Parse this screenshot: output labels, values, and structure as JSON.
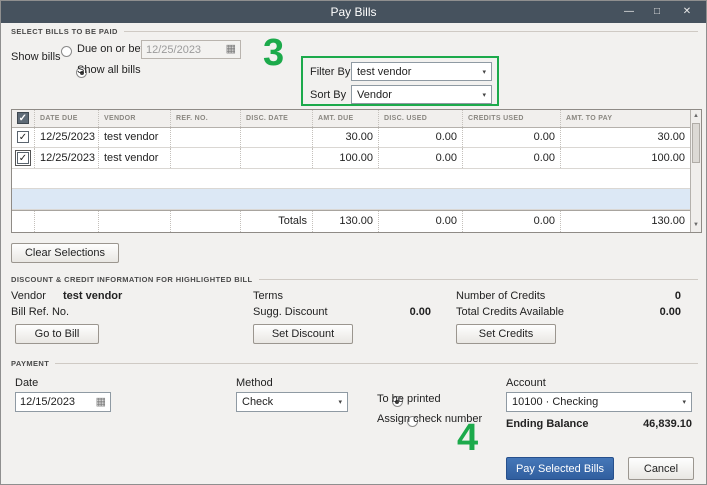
{
  "window": {
    "title": "Pay Bills"
  },
  "icons": {
    "minimize": "—",
    "maximize": "□",
    "close": "✕",
    "dropdown": "▾",
    "calendar": "▦",
    "scroll_up": "▲",
    "scroll_down": "▼",
    "check": "✓"
  },
  "annotations": {
    "step3": "3",
    "step4": "4",
    "color": "#1caa4b"
  },
  "select_bills": {
    "section_title": "SELECT BILLS TO BE PAID",
    "show_bills_label": "Show bills",
    "due_on_or_before_label": "Due on or before",
    "due_date_value": "12/25/2023",
    "show_all_bills_label": "Show all bills",
    "filter_by_label": "Filter By",
    "filter_by_value": "test vendor",
    "sort_by_label": "Sort By",
    "sort_by_value": "Vendor"
  },
  "table": {
    "headers": [
      "DATE DUE",
      "VENDOR",
      "REF. NO.",
      "DISC. DATE",
      "AMT. DUE",
      "DISC. USED",
      "CREDITS USED",
      "AMT. TO PAY"
    ],
    "rows": [
      {
        "checked": true,
        "date_due": "12/25/2023",
        "vendor": "test vendor",
        "ref_no": "",
        "disc_date": "",
        "amt_due": "30.00",
        "disc_used": "0.00",
        "credits_used": "0.00",
        "amt_to_pay": "30.00"
      },
      {
        "checked": true,
        "date_due": "12/25/2023",
        "vendor": "test vendor",
        "ref_no": "",
        "disc_date": "",
        "amt_due": "100.00",
        "disc_used": "0.00",
        "credits_used": "0.00",
        "amt_to_pay": "100.00"
      }
    ],
    "totals_label": "Totals",
    "totals": {
      "amt_due": "130.00",
      "disc_used": "0.00",
      "credits_used": "0.00",
      "amt_to_pay": "130.00"
    }
  },
  "buttons": {
    "clear_selections": "Clear Selections",
    "go_to_bill": "Go to Bill",
    "set_discount": "Set Discount",
    "set_credits": "Set Credits",
    "pay_selected_bills": "Pay Selected Bills",
    "cancel": "Cancel"
  },
  "discount_credit": {
    "section_title": "DISCOUNT & CREDIT INFORMATION FOR HIGHLIGHTED BILL",
    "vendor_label": "Vendor",
    "vendor_value": "test vendor",
    "bill_ref_label": "Bill Ref. No.",
    "terms_label": "Terms",
    "sugg_discount_label": "Sugg. Discount",
    "sugg_discount_value": "0.00",
    "number_credits_label": "Number of Credits",
    "number_credits_value": "0",
    "total_credits_label": "Total Credits Available",
    "total_credits_value": "0.00"
  },
  "payment": {
    "section_title": "PAYMENT",
    "date_label": "Date",
    "date_value": "12/15/2023",
    "method_label": "Method",
    "method_value": "Check",
    "to_be_printed_label": "To be printed",
    "assign_check_label": "Assign check number",
    "account_label": "Account",
    "account_value": "10100 · Checking",
    "ending_balance_label": "Ending Balance",
    "ending_balance_value": "46,839.10"
  }
}
